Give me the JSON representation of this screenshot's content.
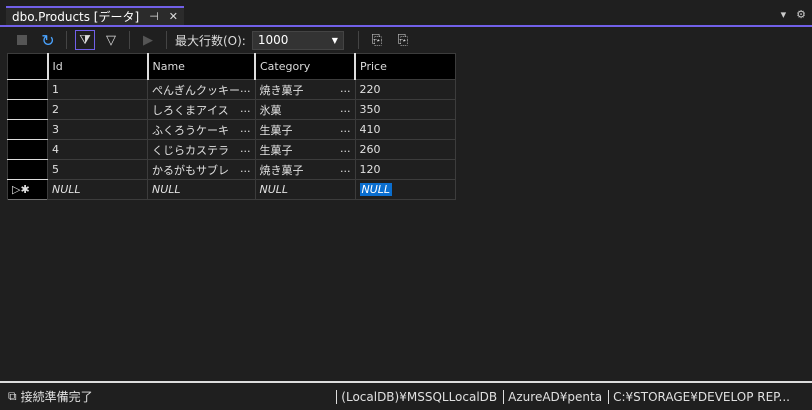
{
  "tab": {
    "title": "dbo.Products [データ]",
    "pin": "⊣",
    "close": "✕"
  },
  "window_icons": {
    "dropdown": "▾",
    "settings": "⚙"
  },
  "toolbar": {
    "max_rows_label": "最大行数(O):",
    "max_rows_value": "1000"
  },
  "grid": {
    "columns": [
      "Id",
      "Name",
      "Category",
      "Price"
    ],
    "rows": [
      {
        "id": "1",
        "name": "ぺんぎんクッキー",
        "category": "焼き菓子",
        "price": "220"
      },
      {
        "id": "2",
        "name": "しろくまアイス",
        "category": "氷菓",
        "price": "350"
      },
      {
        "id": "3",
        "name": "ふくろうケーキ",
        "category": "生菓子",
        "price": "410"
      },
      {
        "id": "4",
        "name": "くじらカステラ",
        "category": "生菓子",
        "price": "260"
      },
      {
        "id": "5",
        "name": "かるがもサブレ",
        "category": "焼き菓子",
        "price": "120"
      }
    ],
    "ellipsis": "...",
    "null_text": "NULL"
  },
  "status": {
    "text": "接続準備完了",
    "server": "(LocalDB)¥MSSQLLocalDB",
    "user": "AzureAD¥penta",
    "path": "C:¥STORAGE¥DEVELOP REP..."
  }
}
